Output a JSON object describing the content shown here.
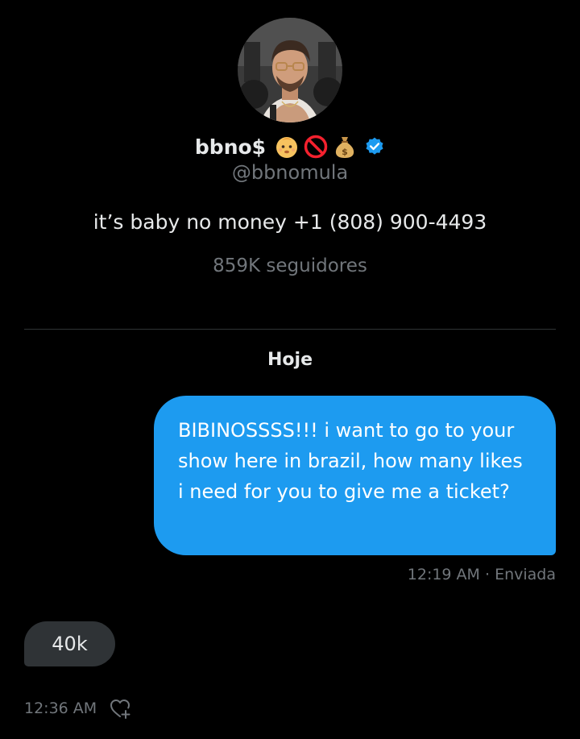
{
  "profile": {
    "display_name": "bbno$",
    "name_emojis": [
      "baby-emoji",
      "prohibited-emoji",
      "money-bag-emoji"
    ],
    "verified": true,
    "handle": "@bbnomula",
    "bio": "it’s baby no money +1 (808) 900-4493",
    "followers": "859K seguidores"
  },
  "conversation": {
    "day_label": "Hoje",
    "messages": [
      {
        "direction": "sent",
        "text": "BIBINOSSSS!!! i want to go to your show here in brazil, how many likes i need for you to give me a ticket?",
        "meta": "12:19 AM · Enviada"
      },
      {
        "direction": "received",
        "text": "40k",
        "meta": "12:36 AM",
        "icon": "add-reaction-icon"
      }
    ]
  },
  "colors": {
    "background": "#000000",
    "sent_bubble": "#1d9bf0",
    "received_bubble": "#2f3336",
    "secondary_text": "#71767b",
    "primary_text": "#e7e9ea",
    "verified_badge": "#1d9bf0"
  }
}
